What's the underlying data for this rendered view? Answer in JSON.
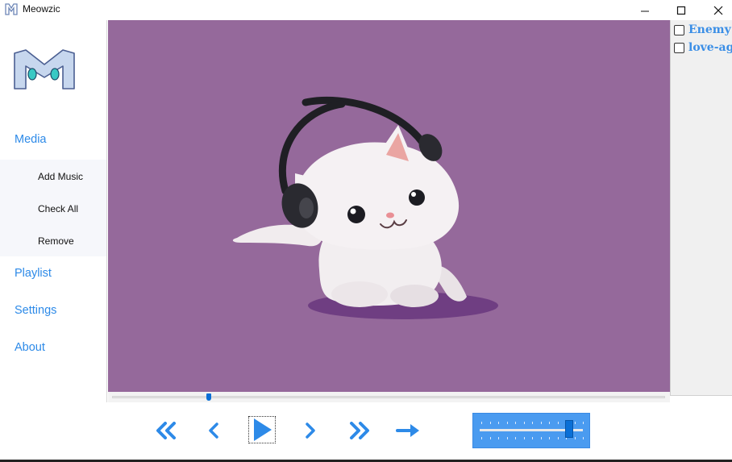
{
  "window": {
    "title": "Meowzic"
  },
  "sidebar": {
    "items": [
      {
        "label": "Media"
      },
      {
        "label": "Playlist"
      },
      {
        "label": "Settings"
      },
      {
        "label": "About"
      }
    ],
    "media_submenu": [
      {
        "label": "Add Music"
      },
      {
        "label": "Check All"
      },
      {
        "label": "Remove"
      }
    ]
  },
  "playlist": {
    "items": [
      {
        "label": "Enemy",
        "checked": false
      },
      {
        "label": "love-again",
        "checked": false
      }
    ]
  },
  "player": {
    "progress_fraction": 0.175,
    "volume_fraction": 0.87,
    "controls": [
      "rewind-fast-icon",
      "previous-icon",
      "play-icon",
      "next-icon",
      "fast-forward-icon",
      "loop-arrow-icon"
    ]
  },
  "colors": {
    "accent": "#2d8ae8",
    "video_background": "#95699b",
    "volume_panel": "#4a9bf0",
    "slider_thumb": "#0a6fd6"
  }
}
